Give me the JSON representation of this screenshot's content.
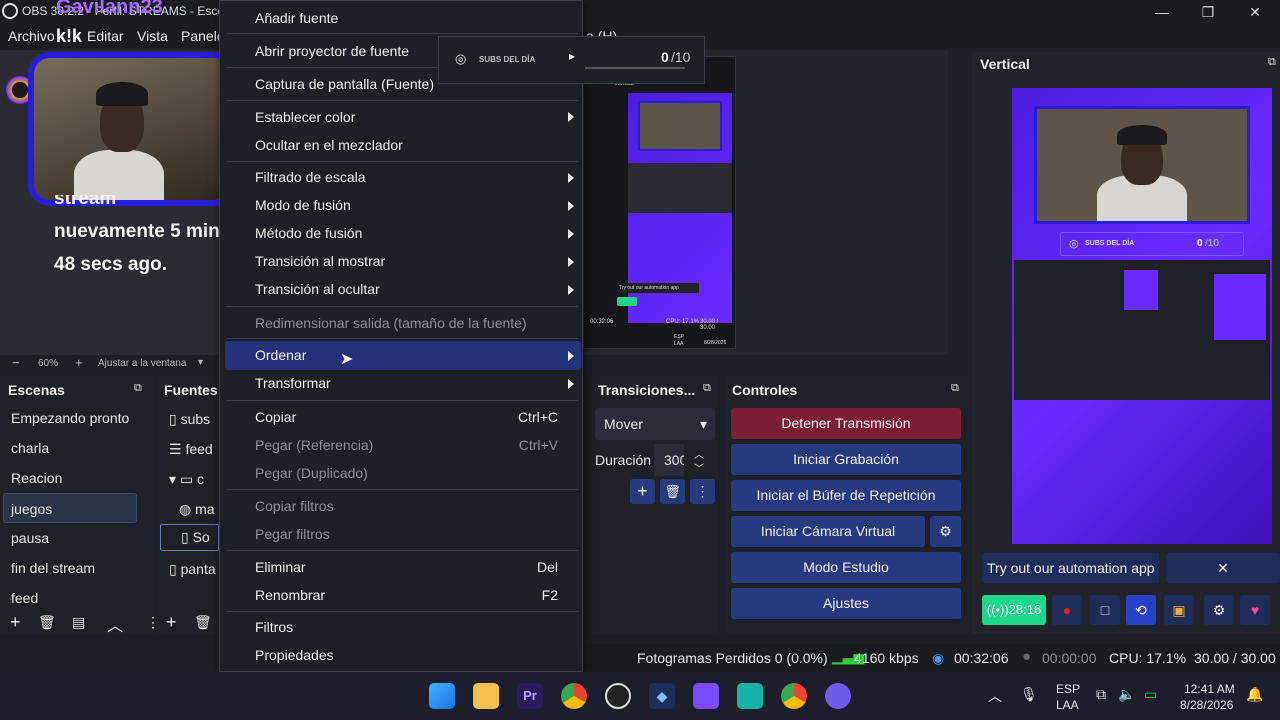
{
  "window": {
    "title": "OBS 30.2.2 - Perfil: STREAMS - Escenas",
    "minimize": "—",
    "maximize": "❐",
    "close": "✕"
  },
  "menubar": [
    "Archivo",
    "Editar",
    "Vista",
    "Panele",
    "a (H)"
  ],
  "preview": {
    "alert_user": "Gavilann23",
    "alert_line1": "stream",
    "alert_line2": "nuevamente 5 min",
    "alert_line3": "48 secs ago.",
    "zoom": "60%",
    "zoom_fit": "Ajustar a la ventana",
    "subs_label": "SUBS DEL DÍA",
    "subs_count": "0",
    "subs_total": "/10"
  },
  "mini_preview": {
    "title": "Vertical",
    "automation": "Try out our automation app",
    "time": "00:32:06",
    "cpu": "CPU: 17.1%",
    "fps": "30.00 / 30.00",
    "lang": "ESP",
    "region": "LAA",
    "date": "8/28/2026"
  },
  "vertical": {
    "title": "Vertical",
    "subs_label": "SUBS DEL DÍA",
    "subs_count": "0",
    "subs_total": "/10",
    "automation_label": "Try out our automation app",
    "close": "✕",
    "live_time": "28:16"
  },
  "scenes": {
    "title": "Escenas",
    "items": [
      "Empezando pronto",
      "charla",
      "Reacion",
      "juegos",
      "pausa",
      "fin del stream",
      "feed"
    ],
    "selected": "juegos"
  },
  "sources": {
    "title": "Fuentes",
    "items": [
      "subs",
      "feed",
      "c",
      "ma",
      "So",
      "panta"
    ]
  },
  "transitions": {
    "title": "Transiciones...",
    "type": "Mover",
    "duration_label": "Duración",
    "duration_value": "300"
  },
  "controls": {
    "title": "Controles",
    "stop_stream": "Detener Transmisión",
    "start_record": "Iniciar Grabación",
    "start_replay": "Iniciar el Búfer de Repetición",
    "start_virtual_cam": "Iniciar Cámara Virtual",
    "studio_mode": "Modo Estudio",
    "settings": "Ajustes"
  },
  "status": {
    "dropped": "Fotogramas Perdidos 0 (0.0%)",
    "bitrate": "4160 kbps",
    "stream_time": "00:32:06",
    "rec_time": "00:00:00",
    "cpu": "CPU: 17.1%",
    "fps": "30.00 / 30.00 F"
  },
  "context_menu": {
    "items": [
      {
        "label": "Añadir fuente"
      },
      {
        "label": "Abrir proyector de fuente",
        "submenu": true
      },
      {
        "label": "Captura de pantalla (Fuente)"
      },
      {
        "label": "Establecer color",
        "submenu": true
      },
      {
        "label": "Ocultar en el mezclador"
      },
      {
        "label": "Filtrado de escala",
        "submenu": true
      },
      {
        "label": "Modo de fusión",
        "submenu": true
      },
      {
        "label": "Método de fusión",
        "submenu": true
      },
      {
        "label": "Transición al mostrar",
        "submenu": true
      },
      {
        "label": "Transición al ocultar",
        "submenu": true
      },
      {
        "label": "Redimensionar salida (tamaño de la fuente)",
        "disabled": true
      },
      {
        "label": "Ordenar",
        "submenu": true,
        "highlighted": true
      },
      {
        "label": "Transformar",
        "submenu": true
      },
      {
        "label": "Copiar",
        "shortcut": "Ctrl+C"
      },
      {
        "label": "Pegar (Referencia)",
        "shortcut": "Ctrl+V",
        "disabled": true
      },
      {
        "label": "Pegar (Duplicado)",
        "disabled": true
      },
      {
        "label": "Copiar filtros",
        "disabled": true
      },
      {
        "label": "Pegar filtros",
        "disabled": true
      },
      {
        "label": "Eliminar",
        "shortcut": "Del"
      },
      {
        "label": "Renombrar",
        "shortcut": "F2"
      },
      {
        "label": "Filtros"
      },
      {
        "label": "Propiedades"
      }
    ]
  },
  "taskbar": {
    "lang": "ESP",
    "region": "LAA",
    "time": "12:41 AM",
    "date": "8/28/2026"
  },
  "colors": {
    "accent": "#2a1cd8",
    "control_button": "#283a7e",
    "stop_button": "#7a1f33",
    "live_badge": "#1fd68a",
    "purple": "#6a2bff"
  }
}
